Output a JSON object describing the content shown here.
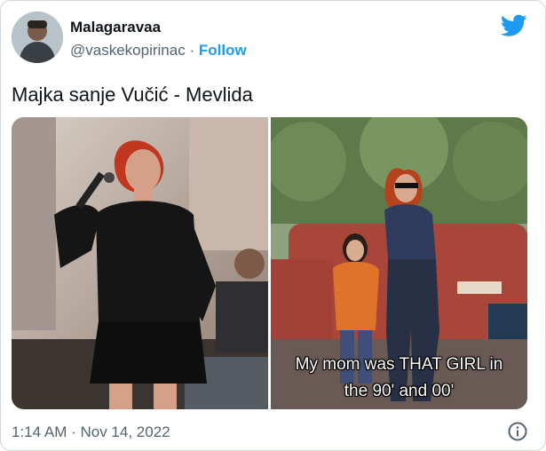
{
  "author": {
    "display_name": "Malagaravaa",
    "handle": "@vaskekopirinac",
    "separator": "·",
    "follow_label": "Follow",
    "avatar_icon": "user-avatar"
  },
  "brand": {
    "icon": "twitter-bird-icon",
    "color": "#1d9bf0"
  },
  "tweet": {
    "text": "Majka sanje Vučić - Mevlida"
  },
  "media": {
    "photo_right_caption_line1": "My mom was THAT GIRL in",
    "photo_right_caption_line2": "the 90' and 00'"
  },
  "footer": {
    "timestamp": "1:14 AM · Nov 14, 2022",
    "info_icon": "info-icon"
  }
}
